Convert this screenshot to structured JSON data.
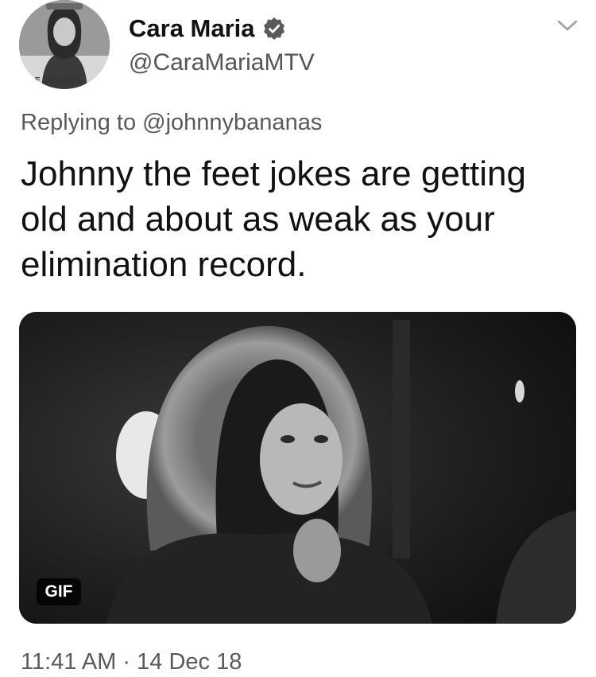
{
  "tweet": {
    "author": {
      "display_name": "Cara Maria",
      "handle": "@CaraMariaMTV",
      "verified": true,
      "avatar_icon": "profile-photo",
      "avatar_text": "E CHALLEN"
    },
    "reply_prefix": "Replying to",
    "reply_to": "@johnnybananas",
    "text_lines": [
      "Johnny the feet jokes are getting",
      "old and about as weak as your",
      "elimination record."
    ],
    "media": {
      "type": "gif",
      "badge_label": "GIF"
    },
    "timestamp": "11:41 AM · 14 Dec 18",
    "menu_icon": "chevron-down-icon"
  }
}
